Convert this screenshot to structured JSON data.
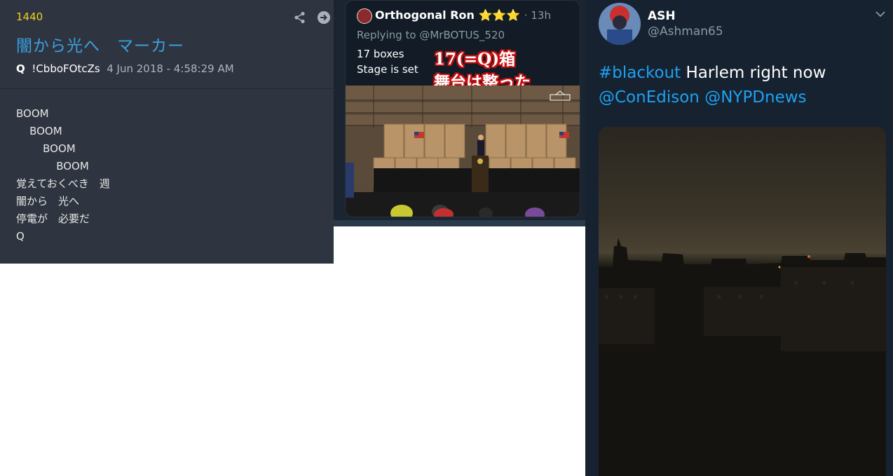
{
  "qpost": {
    "number": "1440",
    "title": "闇から光へ　マーカー",
    "author": "Q",
    "tripcode": "!CbboFOtcZs",
    "date": "4 Jun 2018 - 4:58:29 AM",
    "lines": [
      "BOOM",
      "    BOOM",
      "        BOOM",
      "            BOOM",
      "覚えておくべき　週",
      "闇から　光へ",
      "停電が　必要だ",
      "Q"
    ]
  },
  "tweet_boxes": {
    "name": "Orthogonal Ron",
    "stars": "⭐⭐⭐",
    "time": "· 13h",
    "replying": "Replying to @MrBOTUS_520",
    "line1": "17 boxes",
    "line2": "Stage is set",
    "overlay1": "17(=Q)箱",
    "overlay2": "舞台は整った"
  },
  "tweet_blackout": {
    "name": "ASH",
    "handle": "@Ashman65",
    "hashtag": "#blackout",
    "text": " Harlem right now",
    "mention1": "@ConEdison",
    "mention2": "@NYPDnews"
  },
  "colors": {
    "qpost_bg": "#2f3540",
    "q_number": "#f0d020",
    "q_title": "#3aa0e0",
    "twitter_link": "#1da1f2",
    "overlay_red": "#c81010"
  }
}
